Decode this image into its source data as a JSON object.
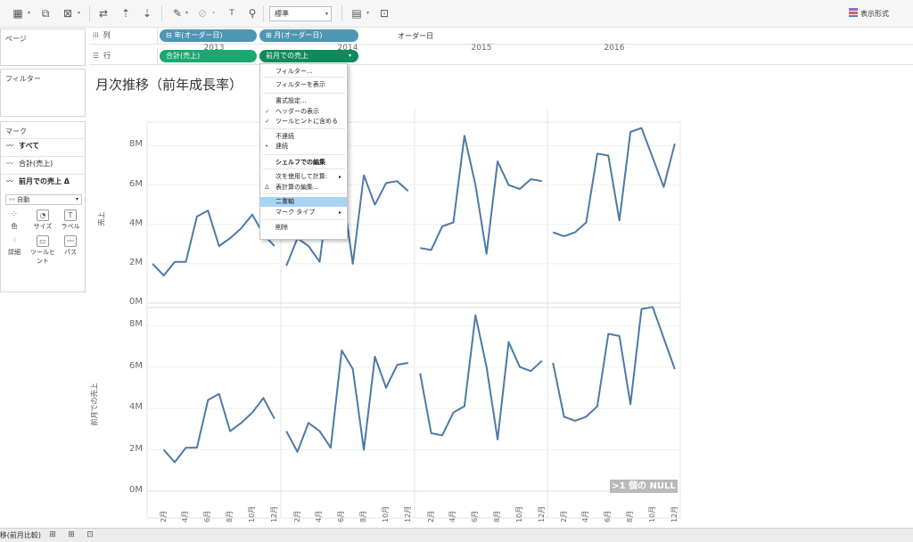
{
  "toolbar": {
    "fit_value": "標準",
    "show_me_label": "表示形式",
    "icons": [
      "new-data-source-icon",
      "duplicate-sheet-icon",
      "clear-sheet-icon",
      "swap-icon",
      "sort-asc-icon",
      "sort-desc-icon",
      "highlight-icon",
      "group-icon",
      "label-icon",
      "pin-icon",
      "chart-icon",
      "presentation-icon"
    ]
  },
  "panes": {
    "pages_title": "ページ",
    "filters_title": "フィルター",
    "marks_title": "マーク",
    "marks_rows": [
      {
        "label": "すべて"
      },
      {
        "label": "合計(売上)"
      },
      {
        "label": "前月での売上 Δ"
      }
    ],
    "mark_type": "自動",
    "mark_buttons": [
      "色",
      "サイズ",
      "ラベル",
      "詳細",
      "ツールヒント",
      "パス"
    ]
  },
  "shelves": {
    "columns_label": "列",
    "rows_label": "行",
    "columns_pills": [
      "⊟ 年(オーダー日)",
      "⊞ 月(オーダー日)"
    ],
    "rows_pills": [
      "合計(売上)",
      "前月での売上"
    ]
  },
  "context_menu": {
    "items": [
      {
        "label": "フィルター..."
      },
      {
        "label": "フィルターを表示"
      },
      {
        "label": "書式設定..."
      },
      {
        "label": "ヘッダーの表示",
        "check": "✓"
      },
      {
        "label": "ツールヒントに含める",
        "check": "✓"
      },
      {
        "label": "不連続"
      },
      {
        "label": "連続",
        "check": "•"
      },
      {
        "label": "シェルフでの編集"
      },
      {
        "label": "次を使用して計算:",
        "sub": "▸"
      },
      {
        "label": "表計算の編集...",
        "check": "Δ"
      },
      {
        "label": "二重軸",
        "highlighted": true
      },
      {
        "label": "マーク タイプ",
        "sub": "▸"
      },
      {
        "label": "削除"
      }
    ]
  },
  "view": {
    "title": "月次推移（前年成長率）",
    "column_header": "オーダー日",
    "years": [
      "2013",
      "2014",
      "2015",
      "2016"
    ],
    "y_axis_top_title": "売上",
    "y_axis_bottom_title": "前月での売上",
    "y_ticks": [
      "0M",
      "2M",
      "4M",
      "6M",
      "8M"
    ],
    "month_ticks": [
      "2月",
      "4月",
      "6月",
      "8月",
      "10月",
      "12月"
    ],
    "null_badge": ">1 個の NULL"
  },
  "chart_data": [
    {
      "type": "line",
      "ylabel": "売上",
      "categories": [
        "1月",
        "2月",
        "3月",
        "4月",
        "5月",
        "6月",
        "7月",
        "8月",
        "9月",
        "10月",
        "11月",
        "12月"
      ],
      "ylim": [
        0,
        9
      ],
      "series": [
        {
          "name": "2013",
          "values": [
            2.0,
            1.4,
            2.1,
            2.1,
            4.4,
            4.7,
            2.9,
            3.3,
            3.8,
            4.5,
            3.5,
            2.9
          ]
        },
        {
          "name": "2014",
          "values": [
            1.9,
            3.3,
            2.9,
            2.1,
            6.4,
            6.0,
            2.0,
            6.5,
            5.0,
            6.1,
            6.2,
            5.7
          ]
        },
        {
          "name": "2015",
          "values": [
            2.8,
            2.7,
            3.9,
            4.1,
            8.5,
            6.0,
            2.5,
            7.2,
            6.0,
            5.8,
            6.3,
            6.2
          ]
        },
        {
          "name": "2016",
          "values": [
            3.6,
            3.4,
            3.6,
            4.1,
            7.6,
            7.5,
            4.2,
            8.7,
            8.9,
            7.4,
            5.9,
            8.1
          ]
        }
      ]
    },
    {
      "type": "line",
      "ylabel": "前月での売上",
      "categories": [
        "1月",
        "2月",
        "3月",
        "4月",
        "5月",
        "6月",
        "7月",
        "8月",
        "9月",
        "10月",
        "11月",
        "12月"
      ],
      "ylim": [
        0,
        9
      ],
      "series": [
        {
          "name": "2013",
          "values": [
            null,
            2.0,
            1.4,
            2.1,
            2.1,
            4.4,
            4.7,
            2.9,
            3.3,
            3.8,
            4.5,
            3.5
          ]
        },
        {
          "name": "2014",
          "values": [
            2.9,
            1.9,
            3.3,
            2.9,
            2.1,
            6.8,
            5.9,
            2.0,
            6.5,
            5.0,
            6.1,
            6.2
          ]
        },
        {
          "name": "2015",
          "values": [
            5.7,
            2.8,
            2.7,
            3.8,
            4.1,
            8.5,
            6.0,
            2.5,
            7.2,
            6.0,
            5.8,
            6.3
          ]
        },
        {
          "name": "2016",
          "values": [
            6.2,
            3.6,
            3.4,
            3.6,
            4.1,
            7.6,
            7.5,
            4.2,
            8.8,
            8.9,
            7.4,
            5.9
          ]
        }
      ]
    }
  ],
  "bottom": {
    "sheet_tab": "月次推移(前月比較)"
  }
}
